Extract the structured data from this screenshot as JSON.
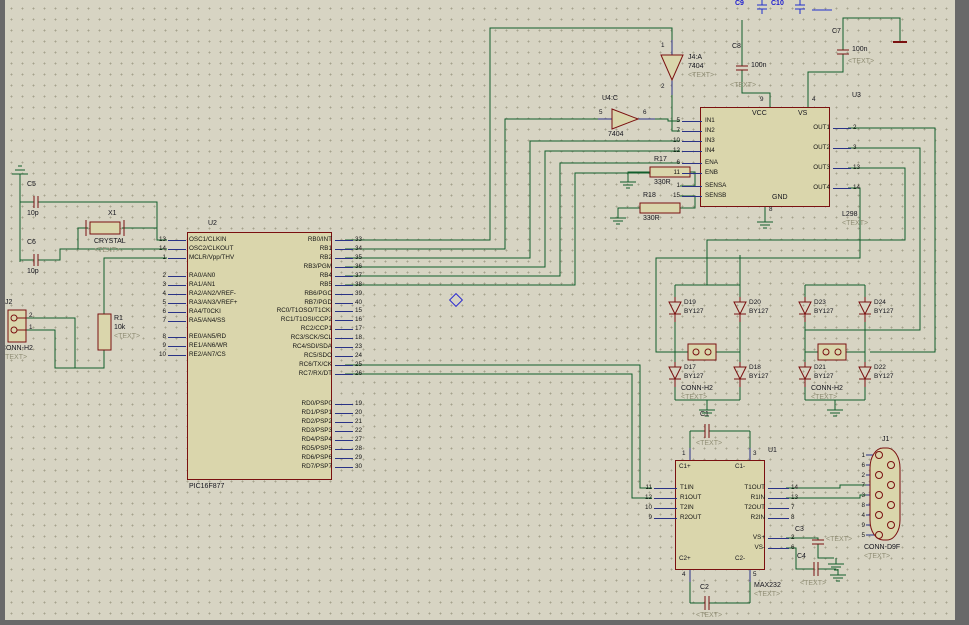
{
  "u2": {
    "ref": "U2",
    "value": "PIC16F877",
    "left_a": [
      {
        "num": "13",
        "name": "OSC1/CLKIN"
      },
      {
        "num": "14",
        "name": "OSC2/CLKOUT"
      },
      {
        "num": "1",
        "name": "MCLR/Vpp/THV"
      }
    ],
    "left_b": [
      {
        "num": "2",
        "name": "RA0/AN0"
      },
      {
        "num": "3",
        "name": "RA1/AN1"
      },
      {
        "num": "4",
        "name": "RA2/AN2/VREF-"
      },
      {
        "num": "5",
        "name": "RA3/AN3/VREF+"
      },
      {
        "num": "6",
        "name": "RA4/T0CKI"
      },
      {
        "num": "7",
        "name": "RA5/AN4/SS"
      }
    ],
    "left_c": [
      {
        "num": "8",
        "name": "RE0/AN5/RD"
      },
      {
        "num": "9",
        "name": "RE1/AN6/WR"
      },
      {
        "num": "10",
        "name": "RE2/AN7/CS"
      }
    ],
    "right_a": [
      {
        "num": "33",
        "name": "RB0/INT"
      },
      {
        "num": "34",
        "name": "RB1"
      },
      {
        "num": "35",
        "name": "RB2"
      },
      {
        "num": "36",
        "name": "RB3/PGM"
      },
      {
        "num": "37",
        "name": "RB4"
      },
      {
        "num": "38",
        "name": "RB5"
      },
      {
        "num": "39",
        "name": "RB6/PGC"
      },
      {
        "num": "40",
        "name": "RB7/PGD"
      }
    ],
    "right_b": [
      {
        "num": "15",
        "name": "RC0/T1OSO/T1CKI"
      },
      {
        "num": "16",
        "name": "RC1/T1OSI/CCP2"
      },
      {
        "num": "17",
        "name": "RC2/CCP1"
      },
      {
        "num": "18",
        "name": "RC3/SCK/SCL"
      },
      {
        "num": "23",
        "name": "RC4/SDI/SDA"
      },
      {
        "num": "24",
        "name": "RC5/SDO"
      },
      {
        "num": "25",
        "name": "RC6/TX/CK"
      },
      {
        "num": "26",
        "name": "RC7/RX/DT"
      }
    ],
    "right_c": [
      {
        "num": "19",
        "name": "RD0/PSP0"
      },
      {
        "num": "20",
        "name": "RD1/PSP1"
      },
      {
        "num": "21",
        "name": "RD2/PSP2"
      },
      {
        "num": "22",
        "name": "RD3/PSP3"
      },
      {
        "num": "27",
        "name": "RD4/PSP4"
      },
      {
        "num": "28",
        "name": "RD5/PSP5"
      },
      {
        "num": "29",
        "name": "RD6/PSP6"
      },
      {
        "num": "30",
        "name": "RD7/PSP7"
      }
    ]
  },
  "u3": {
    "ref": "U3",
    "value": "L298",
    "placeholder": "<TEXT>",
    "left_in": [
      {
        "num": "5",
        "name": "IN1"
      },
      {
        "num": "7",
        "name": "IN2"
      },
      {
        "num": "10",
        "name": "IN3"
      },
      {
        "num": "12",
        "name": "IN4"
      }
    ],
    "left_en": [
      {
        "num": "6",
        "name": "ENA"
      },
      {
        "num": "11",
        "name": "ENB"
      }
    ],
    "left_sens": [
      {
        "num": "1",
        "name": "SENSA"
      },
      {
        "num": "15",
        "name": "SENSB"
      }
    ],
    "right_out": [
      {
        "num": "2",
        "name": "OUT1"
      },
      {
        "num": "3",
        "name": "OUT2"
      },
      {
        "num": "13",
        "name": "OUT3"
      },
      {
        "num": "14",
        "name": "OUT4"
      }
    ],
    "top": {
      "vcc": {
        "num": "9",
        "name": "VCC"
      },
      "vs": {
        "num": "4",
        "name": "VS"
      }
    },
    "bottom": {
      "gnd": {
        "num": "8",
        "name": "GND"
      }
    }
  },
  "u1": {
    "ref": "U1",
    "value": "MAX232",
    "placeholder": "<TEXT>",
    "left": [
      {
        "num": "11",
        "name": "T1IN"
      },
      {
        "num": "12",
        "name": "R1OUT"
      },
      {
        "num": "10",
        "name": "T2IN"
      },
      {
        "num": "9",
        "name": "R2OUT"
      }
    ],
    "right_a": [
      {
        "num": "14",
        "name": "T1OUT"
      },
      {
        "num": "13",
        "name": "R1IN"
      },
      {
        "num": "7",
        "name": "T2OUT"
      },
      {
        "num": "8",
        "name": "R2IN"
      }
    ],
    "right_b": [
      {
        "num": "2",
        "name": "VS+"
      },
      {
        "num": "6",
        "name": "VS-"
      }
    ],
    "corners": {
      "tl": {
        "num": "1",
        "name": "C1+"
      },
      "tr": {
        "num": "3",
        "name": "C1-"
      },
      "bl": {
        "num": "4",
        "name": "C2+"
      },
      "br": {
        "num": "5",
        "name": "C2-"
      }
    }
  },
  "j1": {
    "ref": "J1",
    "value": "CONN-D9F",
    "placeholder": "<TEXT>",
    "pins": [
      "1",
      "6",
      "2",
      "7",
      "3",
      "8",
      "4",
      "9",
      "5"
    ]
  },
  "parts": {
    "x1": {
      "ref": "X1",
      "value": "CRYSTAL",
      "placeholder": "<TEXT>"
    },
    "c5": {
      "ref": "C5",
      "value": "10p"
    },
    "c6": {
      "ref": "C6",
      "value": "10p"
    },
    "r1": {
      "ref": "R1",
      "value": "10k",
      "placeholder": "<TEXT>"
    },
    "j2": {
      "ref": "J2",
      "value": "CONN-H2",
      "placeholder": "<TEXT>",
      "pins": [
        "2",
        "1"
      ]
    },
    "u4c": {
      "ref": "U4:C",
      "value": "7404",
      "pins": [
        "5",
        "6"
      ]
    },
    "j4a": {
      "ref": "J4:A",
      "value": "7404",
      "placeholder": "<TEXT>",
      "pins": [
        "1",
        "2"
      ]
    },
    "c8": {
      "ref": "C8",
      "value": "100n",
      "placeholder": "<TEXT>"
    },
    "c7": {
      "ref": "C7",
      "value": "100n",
      "placeholder": "<TEXT>"
    },
    "r17": {
      "ref": "R17",
      "value": "330R"
    },
    "r18": {
      "ref": "R18",
      "value": "330R"
    },
    "c1": {
      "ref": "C1",
      "placeholder": "<TEXT>"
    },
    "c2": {
      "ref": "C2",
      "placeholder": "<TEXT>"
    },
    "c3": {
      "ref": "C3",
      "placeholder": "<TEXT>"
    },
    "c4": {
      "ref": "C4",
      "placeholder": "<TEXT>"
    }
  },
  "diodes": [
    {
      "ref": "D19",
      "value": "BY127"
    },
    {
      "ref": "D20",
      "value": "BY127"
    },
    {
      "ref": "D23",
      "value": "BY127"
    },
    {
      "ref": "D24",
      "value": "BY127"
    },
    {
      "ref": "D17",
      "value": "BY127"
    },
    {
      "ref": "D18",
      "value": "BY127"
    },
    {
      "ref": "D21",
      "value": "BY127"
    },
    {
      "ref": "D22",
      "value": "BY127"
    }
  ],
  "conn_h2": [
    {
      "value": "CONN-H2",
      "placeholder": "<TEXT>"
    },
    {
      "value": "CONN-H2",
      "placeholder": "<TEXT>"
    }
  ],
  "net_labels": [
    "C9",
    "C10"
  ]
}
